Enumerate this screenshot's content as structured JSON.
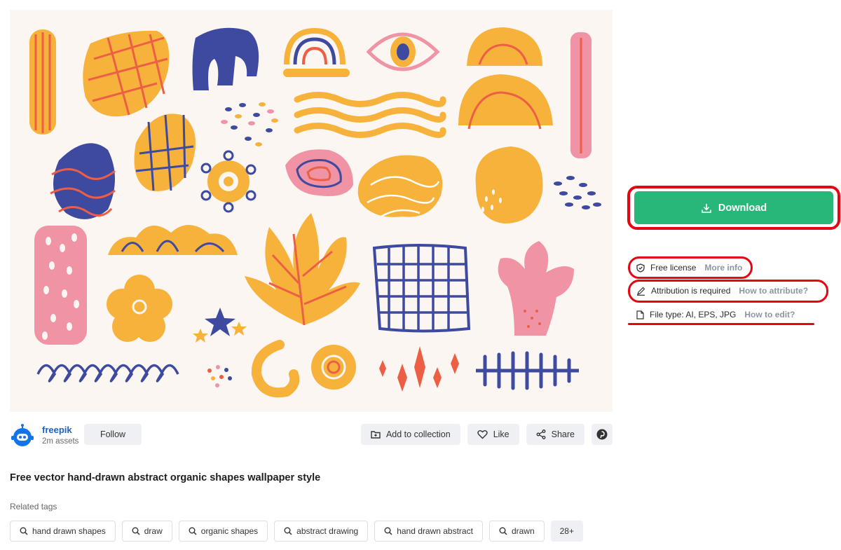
{
  "author": {
    "name": "freepik",
    "assets": "2m assets",
    "follow_label": "Follow"
  },
  "actions": {
    "add_collection": "Add to collection",
    "like": "Like",
    "share": "Share"
  },
  "title": "Free vector hand-drawn abstract organic shapes wallpaper style",
  "related_tags_label": "Related tags",
  "tags": [
    "hand drawn shapes",
    "draw",
    "organic shapes",
    "abstract drawing",
    "hand drawn abstract",
    "drawn"
  ],
  "tags_more": "28+",
  "download_label": "Download",
  "license": {
    "label": "Free license",
    "link": "More info"
  },
  "attribution": {
    "label": "Attribution is required",
    "link": "How to attribute?"
  },
  "file_type": {
    "label": "File type: AI, EPS, JPG",
    "link": "How to edit?"
  },
  "colors": {
    "download": "#28b779",
    "highlight": "#e30613",
    "orange": "#f6b23a",
    "navy": "#3e4aa0",
    "pink": "#ef93a5",
    "coral": "#ec5f45",
    "bg": "#fbf6f1"
  }
}
